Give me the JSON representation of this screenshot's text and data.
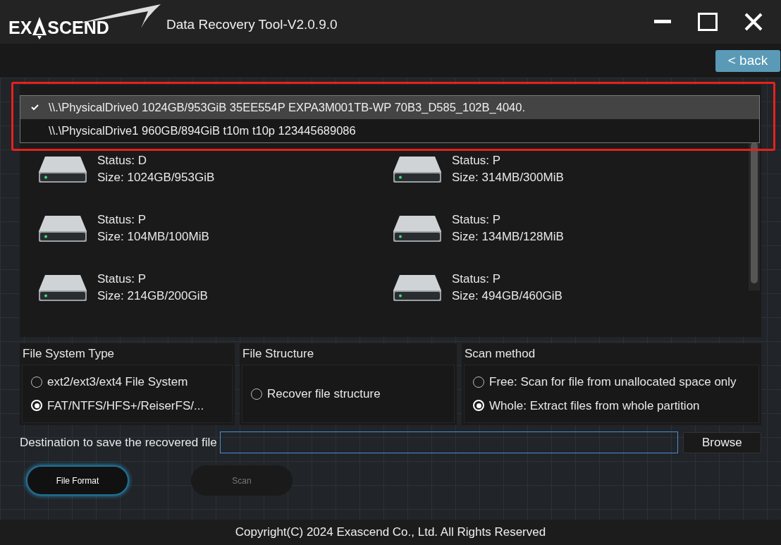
{
  "window": {
    "logo": {
      "left": "EX",
      "right": "SCEND"
    },
    "title": "Data Recovery Tool-V2.0.9.0"
  },
  "back_button": "< back",
  "drives": [
    {
      "label": "\\\\.\\PhysicalDrive0 1024GB/953GiB 35EE554P EXPA3M001TB-WP 70B3_D585_102B_4040.",
      "selected": true
    },
    {
      "label": "\\\\.\\PhysicalDrive1 960GB/894GiB  t10m t10p 123445689086",
      "selected": false
    }
  ],
  "partitions": [
    {
      "status": "Status: D",
      "size": "Size: 1024GB/953GiB"
    },
    {
      "status": "Status: P",
      "size": "Size: 314MB/300MiB"
    },
    {
      "status": "Status: P",
      "size": "Size: 104MB/100MiB"
    },
    {
      "status": "Status: P",
      "size": "Size: 134MB/128MiB"
    },
    {
      "status": "Status: P",
      "size": "Size: 214GB/200GiB"
    },
    {
      "status": "Status: P",
      "size": "Size: 494GB/460GiB"
    }
  ],
  "option_groups": [
    {
      "title": "File System Type",
      "options": [
        {
          "label": "ext2/ext3/ext4 File System",
          "selected": false
        },
        {
          "label": "FAT/NTFS/HFS+/ReiserFS/...",
          "selected": true
        }
      ]
    },
    {
      "title": "File Structure",
      "options": [
        {
          "label": "Recover file structure",
          "selected": false
        }
      ]
    },
    {
      "title": "Scan method",
      "options": [
        {
          "label": "Free: Scan for file from unallocated space only",
          "selected": false
        },
        {
          "label": "Whole: Extract files from whole partition",
          "selected": true
        }
      ]
    }
  ],
  "destination": {
    "label": "Destination to save the recovered file",
    "browse": "Browse"
  },
  "buttons": [
    {
      "label": "File Format",
      "disabled": false
    },
    {
      "label": "Scan",
      "disabled": true
    }
  ],
  "footer": "Copyright(C) 2024 Exascend Co., Ltd. All Rights Reserved"
}
